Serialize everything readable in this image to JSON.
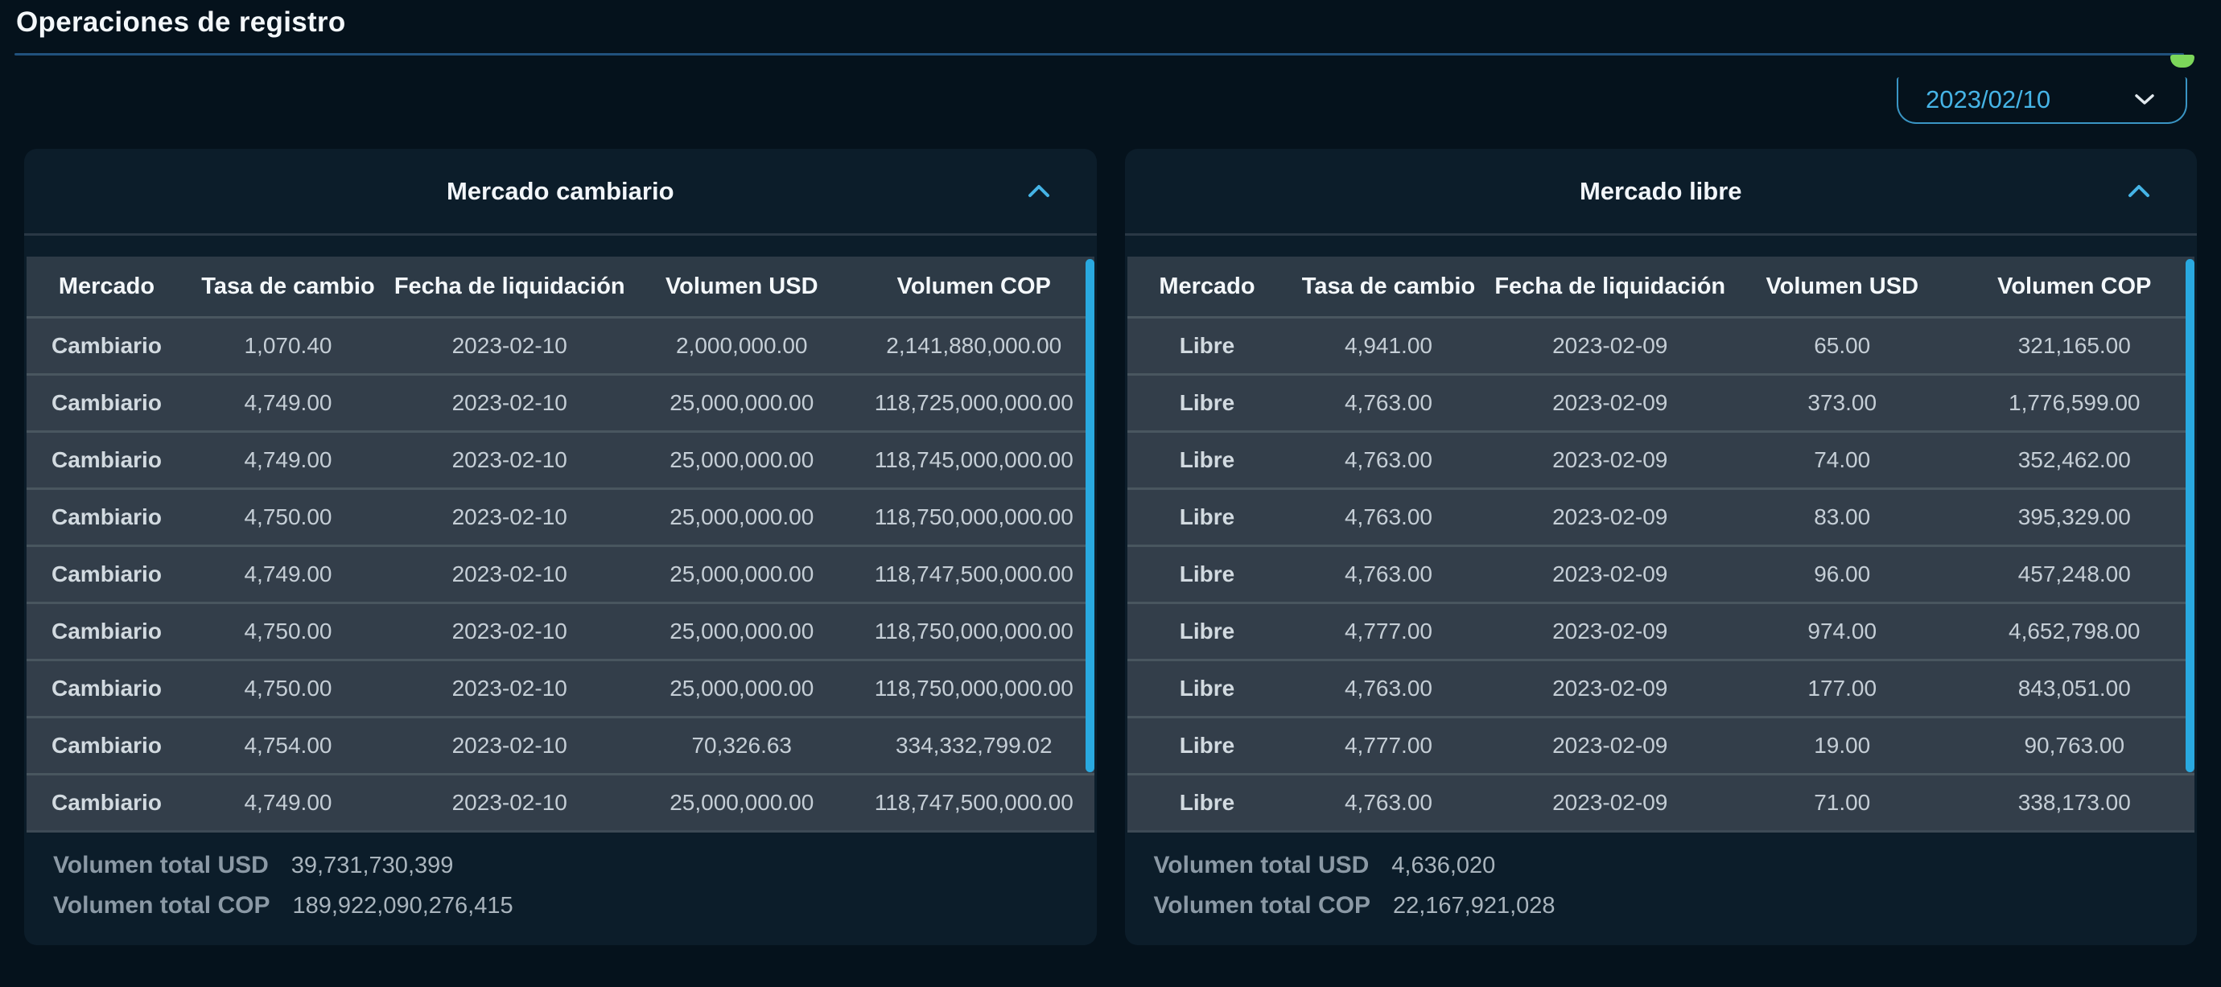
{
  "page": {
    "title": "Operaciones de registro"
  },
  "date_picker": {
    "value": "2023/02/10",
    "icon": "chevron-down"
  },
  "status_indicator": {
    "color": "#7cd65a"
  },
  "colors": {
    "page_bg": "#05121c",
    "card_bg": "#0c1d2a",
    "table_header_bg": "#2d3a46",
    "table_row_bg": "#333e4a",
    "accent_blue": "#46b4e6",
    "scrollbar_blue": "#29a9e0",
    "top_divider_blue": "#21527d",
    "status_green": "#7cd65a"
  },
  "cards": [
    {
      "title": "Mercado cambiario",
      "collapse_icon": "chevron-up",
      "columns": [
        "Mercado",
        "Tasa de cambio",
        "Fecha de liquidación",
        "Volumen USD",
        "Volumen COP"
      ],
      "rows": [
        [
          "Cambiario",
          "1,070.40",
          "2023-02-10",
          "2,000,000.00",
          "2,141,880,000.00"
        ],
        [
          "Cambiario",
          "4,749.00",
          "2023-02-10",
          "25,000,000.00",
          "118,725,000,000.00"
        ],
        [
          "Cambiario",
          "4,749.00",
          "2023-02-10",
          "25,000,000.00",
          "118,745,000,000.00"
        ],
        [
          "Cambiario",
          "4,750.00",
          "2023-02-10",
          "25,000,000.00",
          "118,750,000,000.00"
        ],
        [
          "Cambiario",
          "4,749.00",
          "2023-02-10",
          "25,000,000.00",
          "118,747,500,000.00"
        ],
        [
          "Cambiario",
          "4,750.00",
          "2023-02-10",
          "25,000,000.00",
          "118,750,000,000.00"
        ],
        [
          "Cambiario",
          "4,750.00",
          "2023-02-10",
          "25,000,000.00",
          "118,750,000,000.00"
        ],
        [
          "Cambiario",
          "4,754.00",
          "2023-02-10",
          "70,326.63",
          "334,332,799.02"
        ],
        [
          "Cambiario",
          "4,749.00",
          "2023-02-10",
          "25,000,000.00",
          "118,747,500,000.00"
        ]
      ],
      "totals": [
        {
          "label": "Volumen total USD",
          "value": "39,731,730,399"
        },
        {
          "label": "Volumen total COP",
          "value": "189,922,090,276,415"
        }
      ]
    },
    {
      "title": "Mercado libre",
      "collapse_icon": "chevron-up",
      "columns": [
        "Mercado",
        "Tasa de cambio",
        "Fecha de liquidación",
        "Volumen USD",
        "Volumen COP"
      ],
      "rows": [
        [
          "Libre",
          "4,941.00",
          "2023-02-09",
          "65.00",
          "321,165.00"
        ],
        [
          "Libre",
          "4,763.00",
          "2023-02-09",
          "373.00",
          "1,776,599.00"
        ],
        [
          "Libre",
          "4,763.00",
          "2023-02-09",
          "74.00",
          "352,462.00"
        ],
        [
          "Libre",
          "4,763.00",
          "2023-02-09",
          "83.00",
          "395,329.00"
        ],
        [
          "Libre",
          "4,763.00",
          "2023-02-09",
          "96.00",
          "457,248.00"
        ],
        [
          "Libre",
          "4,777.00",
          "2023-02-09",
          "974.00",
          "4,652,798.00"
        ],
        [
          "Libre",
          "4,763.00",
          "2023-02-09",
          "177.00",
          "843,051.00"
        ],
        [
          "Libre",
          "4,777.00",
          "2023-02-09",
          "19.00",
          "90,763.00"
        ],
        [
          "Libre",
          "4,763.00",
          "2023-02-09",
          "71.00",
          "338,173.00"
        ]
      ],
      "totals": [
        {
          "label": "Volumen total USD",
          "value": "4,636,020"
        },
        {
          "label": "Volumen total COP",
          "value": "22,167,921,028"
        }
      ]
    }
  ]
}
